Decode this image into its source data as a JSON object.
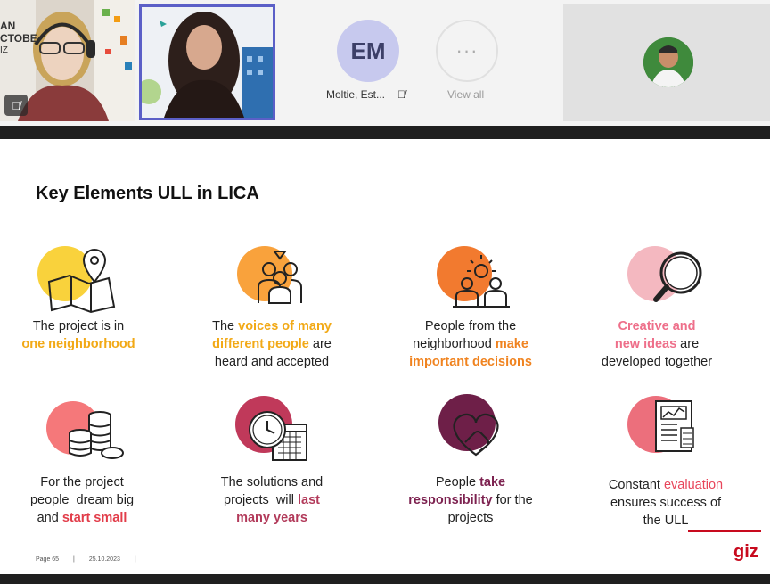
{
  "meeting": {
    "participants": [
      {
        "name": "",
        "muted": true
      },
      {
        "name": ""
      },
      {
        "initials": "EM",
        "name": "Moltie, Est...",
        "muted": true
      },
      {
        "label": "View all",
        "glyph": "···"
      },
      {
        "name": ""
      }
    ],
    "tile1_partial_text": [
      "AN",
      "CTOBE",
      "IZ"
    ]
  },
  "slide": {
    "title": "Key Elements ULL in LICA",
    "items": [
      {
        "icon": "map-pin-icon",
        "line1_pre": "The project is in",
        "line2_hl": "one neighborhood",
        "color": "#f9d23c"
      },
      {
        "icon": "group-people-icon",
        "pre": "The ",
        "hl1": "voices of many",
        "hl2": "different people",
        "post": " are",
        "line3": "heard and accepted",
        "color": "#f9a23c"
      },
      {
        "icon": "team-idea-icon",
        "line1": "People from the",
        "line2_pre": "neighborhood ",
        "line2_hl": "make",
        "line3_hl": "important decisions",
        "color": "#f27a2f"
      },
      {
        "icon": "magnifier-icon",
        "hl1": "Creative and",
        "hl2": "new ideas",
        "post": " are",
        "line3": "developed together",
        "color": "#f4b8c0"
      },
      {
        "icon": "coins-icon",
        "line1": "For the project",
        "line2": "people  dream big",
        "line3_pre": "and ",
        "line3_hl": "start small",
        "color": "#f5787a"
      },
      {
        "icon": "calendar-clock-icon",
        "line1": "The solutions and",
        "line2_pre": "projects  will ",
        "line2_hl": "last",
        "line3_hl": "many years",
        "color": "#c0395a"
      },
      {
        "icon": "heart-hand-icon",
        "line1_pre": "People ",
        "line1_hl": "take",
        "line2_hl": "responsibility",
        "line2_post": " for the",
        "line3": "projects",
        "color": "#6e1f48"
      },
      {
        "icon": "report-icon",
        "line1_pre": "Constant ",
        "line1_hl": "evaluation",
        "line2": "ensures success of",
        "line3": "the ULL",
        "color": "#ec6f7c"
      }
    ],
    "footer": {
      "page": "Page 65",
      "sep": "|",
      "date": "25.10.2023",
      "sep2": "|"
    },
    "logo": "giz"
  }
}
